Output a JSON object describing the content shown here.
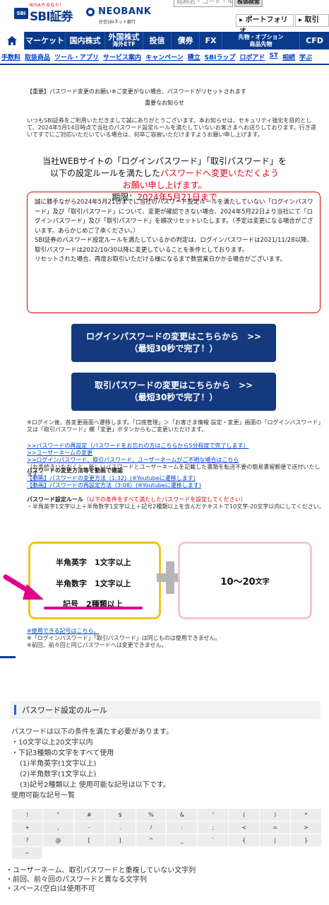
{
  "header": {
    "sbi_tagline": "NISAやるなら！",
    "sbi_mark": "SBI",
    "sbi_name": "SBI証券",
    "neo_name": "NEOBANK",
    "neo_sub": "住信SBIネット銀行",
    "search_placeholder": "銘柄名・コード・キー",
    "search_button": "株価検索",
    "portfolio_button": "▸ ポートフォリオ",
    "trade_button": "▸ 取引"
  },
  "main_nav": [
    {
      "label": "マーケット"
    },
    {
      "label": "国内株式"
    },
    {
      "label1": "外国株式",
      "label2": "海外ETF"
    },
    {
      "label": "投信"
    },
    {
      "label": "債券"
    },
    {
      "label": "FX"
    },
    {
      "label1": "先物・オプション",
      "label2": "商品先物"
    },
    {
      "label": "CFD"
    }
  ],
  "sub_nav": [
    "手数料",
    "取扱商品",
    "ツール・アプリ",
    "サービス案内",
    "キャンペーン",
    "積立",
    "SBIラップ",
    "ロボアド",
    "ST",
    "相続",
    "学ぶ"
  ],
  "notice": {
    "title": "【重要】パスワード変更のお願い※ご変更がない場合、パスワードがリセットされます",
    "subtitle": "重要なお知らせ",
    "intro": "いつもSBI証券をご利用いただきまして誠にありがとうございます。本お知らせは、セキュリティ強化を目的として、2024年5月14日時点で当社のパスワード設定ルールを満たしていないお客さまへお送りしております。行き違いですでにご対応いただいている場合は、何卒ご容赦いただけますようお願い申し上げます。",
    "headline_1": "当社WEBサイトの「ログインパスワード」「取引パスワード」を",
    "headline_2a": "以下の設定ルールを満たした",
    "headline_2b": "パスワードへ変更いただくよう",
    "headline_3": "お願い申し上げます。",
    "deadline_label": "期限：",
    "deadline_value": "2024年5月21日まで"
  },
  "warning_box": {
    "p1": "誠に勝手ながら2024年5月21日までに当社のパスワード設定ルールを満たしていない「ログインパスワード」及び「取引パスワード」について、変更が確認できない場合、2024年5月22日より当社にて「ログインパスワード」及び「取引パスワード」を順次リセットいたします。（予定は変更になる場合がございます。あらかじめご了承ください。）",
    "p2": "SBI証券のパスワード設定ルールを満たしているかの判定は、ログインパスワードは2021/11/28以降、取引パスワードは2022/10/30以降に変更していることを条件としております。",
    "p3": "リセットされた場合、再度お取引いただける様になるまで数営業日かかる場合がございます。"
  },
  "buttons": {
    "login_line1": "ログインパスワードの変更はこちらから　>>",
    "login_line2": "（最短30秒で完了！）",
    "trade_line1": "取引パスワードの変更はこちらから　>>",
    "trade_line2": "（最短30秒で完了！）"
  },
  "note_after_buttons": "※ログイン後、各変更画面へ遷移します。「口座管理」＞「お客さま情報 設定・変更」画面の「ログインパスワード」又は「取引パスワード」欄「変更」ボタンからもご変更いただけます。",
  "links": {
    "reset": ">>パスワードの再設定（パスワードをお忘れの方はこちらから5分程度で完了します）",
    "username": ">>ユーザーネームの変更",
    "unknown": ">>ログインパスワード、取引パスワード、ユーザーネームがご不明な場合はこちら",
    "unknown_note": "（お手続きいただくと、新しいパスワードとユーザーネームを記載した書類を転送不要の簡易書留郵便で送付いたします。）"
  },
  "video": {
    "heading": "パスワードの変更方法等を動画で確認",
    "link1": "【動画】パスワードの変更方法（1:32）(※Youtubeに遷移します)",
    "link2": "【動画】パスワードの再設定方法（3:08）(※Youtubeに遷移します)"
  },
  "rule_summary": {
    "heading": "パスワード設定ルール",
    "heading_red": "（以下の条件をすべて満たしたパスワードを設定してください）",
    "desc": "・半角英字1文字以上＋半角数字1文字以上＋記号2種類以上を含んだテキストで10文字-20文字以内にしてください。"
  },
  "rule_cards": {
    "row1_label": "半角英字",
    "row1_value": "1文字以上",
    "row2_label": "半角数字",
    "row2_value": "1文字以上",
    "row3_label": "記号",
    "row3_value": "2種類以上",
    "length_value": "10〜20",
    "length_unit": "文字"
  },
  "footnotes": {
    "n1": "※使用できる記号はこちら。",
    "n2": "※「ログインパスワード」「取引パスワード」は同じものは使用できません。",
    "n3": "※前回、前々回と同じパスワードへは変更できません。"
  },
  "section": {
    "title": "パスワード設定のルール",
    "l1": "パスワードは以下の条件を満たす必要があります。",
    "l2": "・10文字以上20文字以内",
    "l3": "・下記3種類の文字をすべて使用",
    "l4": "(1)半角英字(1文字以上)",
    "l5": "(2)半角数字(1文字以上)",
    "l6": "(3)記号2種類以上 使用可能な記号は以下です。",
    "l7": "使用可能な記号一覧"
  },
  "symbols": [
    [
      "!",
      "\"",
      "#",
      "$",
      "%",
      "&",
      "'",
      "(",
      ")",
      "*"
    ],
    [
      "+",
      ",",
      "-",
      ".",
      "/",
      ":",
      ";",
      "<",
      "=",
      ">"
    ],
    [
      "?",
      "@",
      "[",
      "]",
      "^",
      "_",
      "`",
      "{",
      "|",
      "}"
    ],
    [
      "~",
      "",
      "",
      "",
      "",
      "",
      "",
      "",
      "",
      ""
    ]
  ],
  "bottom": {
    "b1": "・ユーザーネーム、取引パスワードと重複していない文字列",
    "b2": "・前回、前々回のパスワードと異なる文字列",
    "b3": "・スペース(空白)は使用不可"
  },
  "colors": {
    "brand": "#0a3a8c",
    "accent_red": "#e2001a",
    "card_yellow": "#f5c31b",
    "card_pink": "#f7c5cc",
    "underline_magenta": "#e0008a"
  }
}
